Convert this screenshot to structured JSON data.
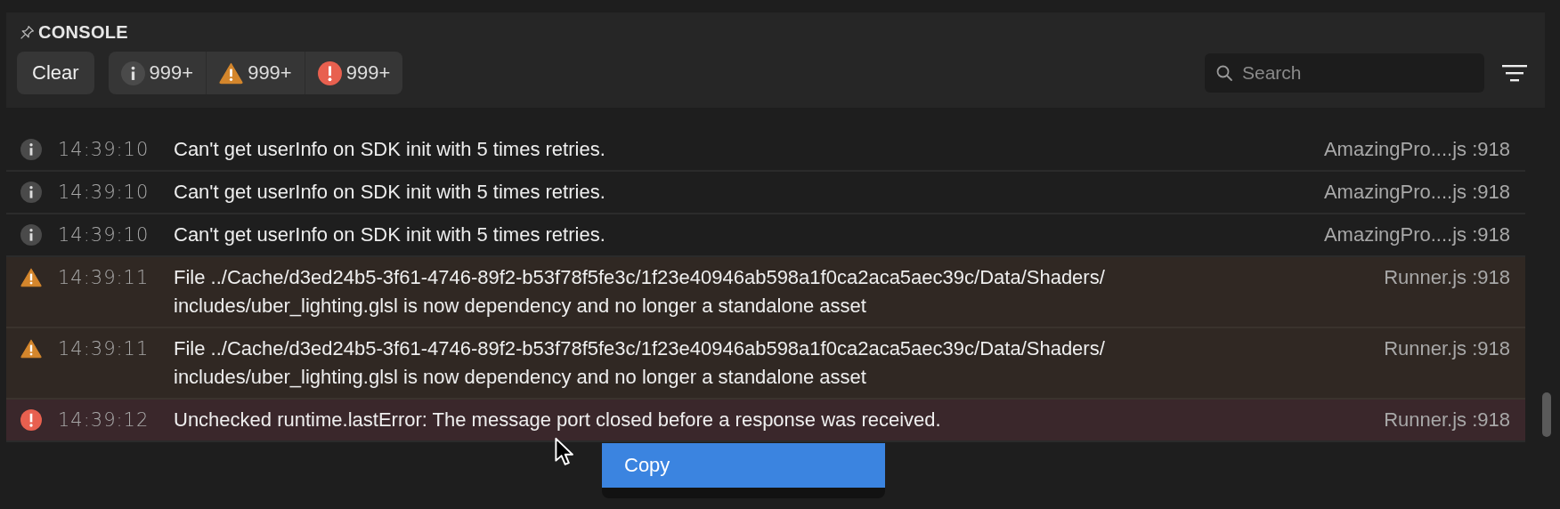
{
  "panel": {
    "title": "CONSOLE"
  },
  "toolbar": {
    "clear_label": "Clear",
    "counters": [
      {
        "kind": "info",
        "count": "999+"
      },
      {
        "kind": "warning",
        "count": "999+"
      },
      {
        "kind": "error",
        "count": "999+"
      }
    ],
    "search": {
      "placeholder": "Search"
    }
  },
  "rows": [
    {
      "kind": "info",
      "time": "14:39:10",
      "message": "Can't get userInfo on SDK init with 5 times retries.",
      "source": "AmazingPro....js :918"
    },
    {
      "kind": "info",
      "time": "14:39:10",
      "message": "Can't get userInfo on SDK init with 5 times retries.",
      "source": "AmazingPro....js :918"
    },
    {
      "kind": "info",
      "time": "14:39:10",
      "message": "Can't get userInfo on SDK init with 5 times retries.",
      "source": "AmazingPro....js :918"
    },
    {
      "kind": "warning",
      "time": "14:39:11",
      "message": "File ../Cache/d3ed24b5-3f61-4746-89f2-b53f78f5fe3c/1f23e40946ab598a1f0ca2aca5aec39c/Data/Shaders/ includes/uber_lighting.glsl is now dependency and no longer a standalone asset",
      "source": "Runner.js :918"
    },
    {
      "kind": "warning",
      "time": "14:39:11",
      "message": "File ../Cache/d3ed24b5-3f61-4746-89f2-b53f78f5fe3c/1f23e40946ab598a1f0ca2aca5aec39c/Data/Shaders/ includes/uber_lighting.glsl is now dependency and no longer a standalone asset",
      "source": "Runner.js :918"
    },
    {
      "kind": "error",
      "time": "14:39:12",
      "message": "Unchecked runtime.lastError: The message port closed before a response was received.",
      "source": "Runner.js :918"
    }
  ],
  "context_menu": {
    "items": [
      {
        "label": "Copy",
        "selected": true
      }
    ]
  }
}
